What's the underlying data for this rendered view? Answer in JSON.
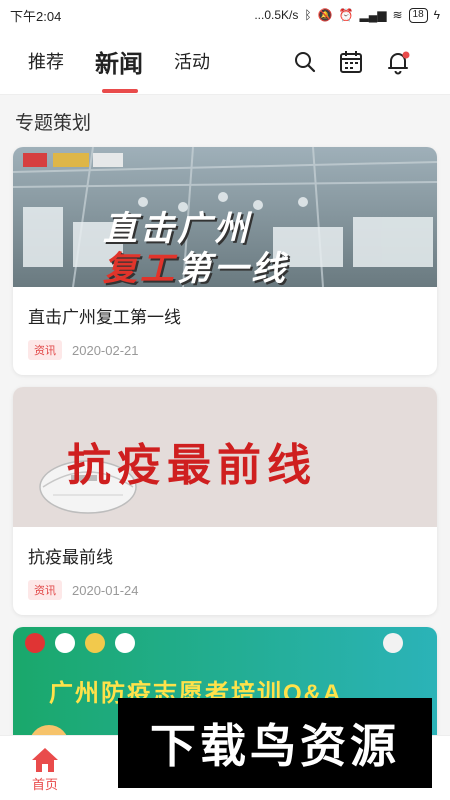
{
  "status_bar": {
    "time": "下午2:04",
    "net_speed": "...0.5K/s",
    "battery": "18"
  },
  "top_nav": {
    "tabs": [
      {
        "label": "推荐"
      },
      {
        "label": "新闻"
      },
      {
        "label": "活动"
      }
    ],
    "active_tab": "新闻"
  },
  "section": {
    "title": "专题策划"
  },
  "cards": [
    {
      "image_text_line1": "直击广州",
      "image_text_line2a": "复工",
      "image_text_line2b": "第一线",
      "title": "直击广州复工第一线",
      "tag": "资讯",
      "date": "2020-02-21"
    },
    {
      "image_text": "抗疫最前线",
      "title": "抗疫最前线",
      "tag": "资讯",
      "date": "2020-01-24"
    },
    {
      "image_text": "广州防疫志愿者培训Q&A"
    }
  ],
  "bottom_nav": {
    "items": [
      {
        "label": "首页"
      }
    ]
  },
  "watermark": {
    "text": "下载鸟资源"
  },
  "colors": {
    "accent": "#e94b4b",
    "tag_bg": "#fde8e8"
  }
}
